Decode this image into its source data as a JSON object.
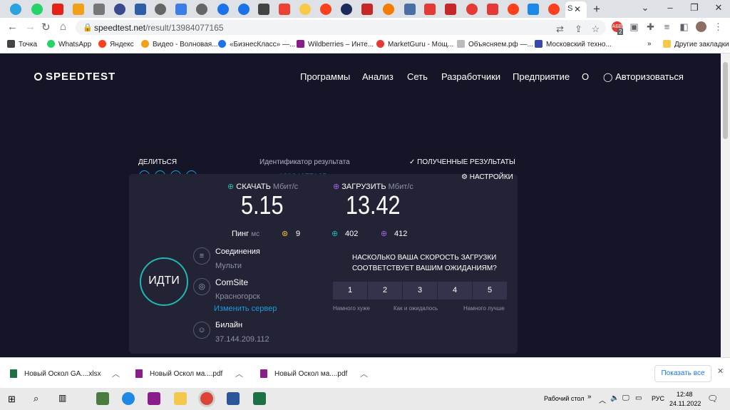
{
  "browser": {
    "active_tab_label": "S",
    "url_host": "speedtest.net",
    "url_path": "/result/13984077165",
    "profile_badge": "2",
    "bookmarks": [
      "Точка",
      "WhatsApp",
      "Яндекс",
      "Видео - Волновая...",
      "«БизнесКласс» —...",
      "Wildberries – Инте...",
      "MarketGuru - Мощ...",
      "Объясняем.рф —...",
      "Московский техно..."
    ],
    "bookmarks_more": "»",
    "other_bookmarks": "Другие закладки"
  },
  "site": {
    "logo": "SPEEDTEST",
    "nav": [
      "Программы",
      "Анализ",
      "Сеть",
      "Разработчики",
      "Предприятие",
      "О"
    ],
    "login": "Авторизоваться",
    "share_label": "ДЕЛИТЬСЯ",
    "result_id_label": "Идентификатор результата",
    "result_id": "13984077165",
    "results_link": "ПОЛУЧЕННЫЕ РЕЗУЛЬТАТЫ",
    "settings_link": "НАСТРОЙКИ",
    "download_label": "СКАЧАТЬ",
    "download_unit": "Мбит/с",
    "download_value": "5.15",
    "upload_label": "ЗАГРУЗИТЬ",
    "upload_unit": "Мбит/с",
    "upload_value": "13.42",
    "ping_label": "Пинг",
    "ping_unit": "мс",
    "ping_idle": "9",
    "ping_down": "402",
    "ping_up": "412",
    "go_button": "ИДТИ",
    "connections_title": "Соединения",
    "connections_value": "Мульти",
    "server_name": "ComSite",
    "server_city": "Красногорск",
    "change_server": "Изменить сервер",
    "isp_name": "Билайн",
    "isp_ip": "37.144.209.112",
    "survey_question_1": "НАСКОЛЬКО ВАША СКОРОСТЬ ЗАГРУЗКИ",
    "survey_question_2": "СООТВЕТСТВУЕТ ВАШИМ ОЖИДАНИЯМ?",
    "ratings": [
      "1",
      "2",
      "3",
      "4",
      "5"
    ],
    "rating_low": "Намного хуже",
    "rating_mid": "Как и ожидалось",
    "rating_high": "Намного лучше"
  },
  "downloads": {
    "items": [
      "Новый  Оскол GA....xlsx",
      "Новый  Оскол ма....pdf",
      "Новый  Оскол ма....pdf"
    ],
    "show_all": "Показать все"
  },
  "taskbar": {
    "desktop_label": "Рабочий стол",
    "language": "РУС",
    "time": "12:48",
    "date": "24.11.2022"
  },
  "colors": {
    "accent_blue": "#1c9bd7",
    "accent_teal": "#1fb7b0",
    "upload_purple": "#a260e6",
    "ping_yellow": "#e8c83c"
  }
}
